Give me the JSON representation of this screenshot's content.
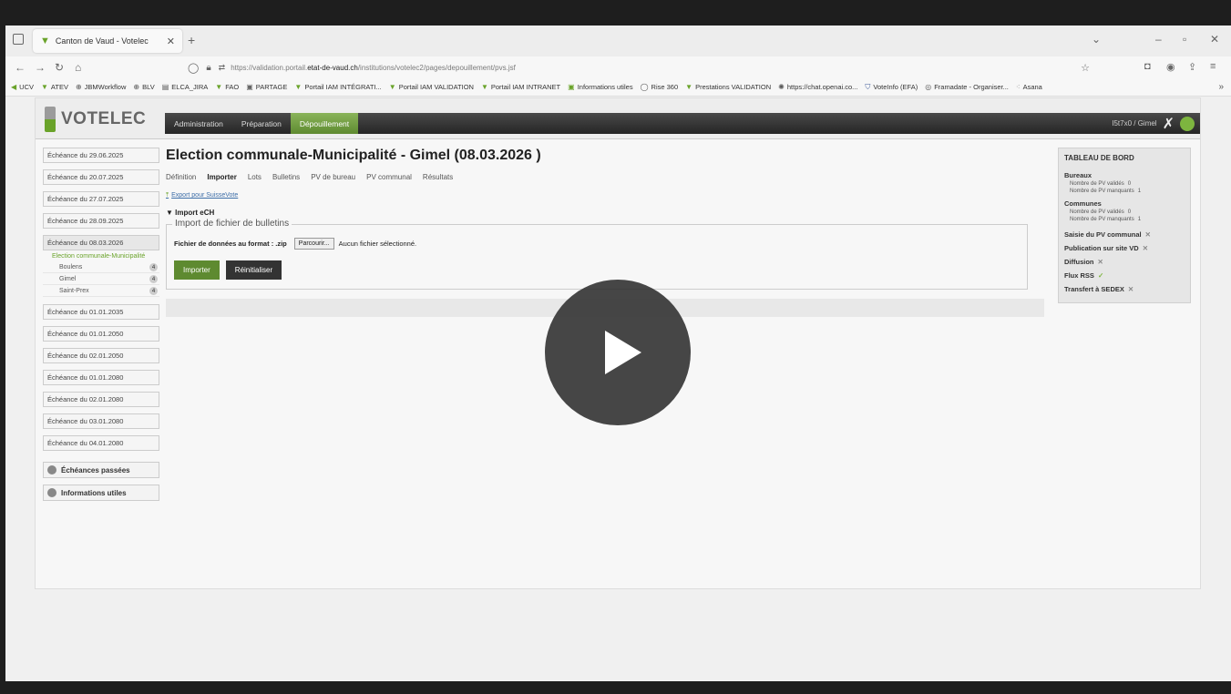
{
  "browser": {
    "tab_title": "Canton de Vaud - Votelec",
    "url_prefix": "https://validation.portail.",
    "url_domain": "etat-de-vaud.ch",
    "url_path": "/institutions/votelec2/pages/depouillement/pvs.jsf",
    "bookmarks": [
      "UCV",
      "ATEV",
      "JBMWorkflow",
      "BLV",
      "ELCA_JIRA",
      "FAO",
      "PARTAGE",
      "Portail IAM INTÉGRATI...",
      "Portail IAM VALIDATION",
      "Portail IAM INTRANET",
      "Informations utiles",
      "Rise 360",
      "Prestations VALIDATION",
      "https://chat.openai.co...",
      "VoteInfo (EFA)",
      "Framadate - Organiser...",
      "Asana"
    ]
  },
  "app": {
    "brand": "VOTELEC",
    "menu": [
      "Administration",
      "Préparation",
      "Dépouillement"
    ],
    "active_menu": "Dépouillement",
    "user": "I5t7x0 / Gimel"
  },
  "left": {
    "items_before": [
      "Échéance du 29.06.2025",
      "Échéance du 20.07.2025",
      "Échéance du 27.07.2025",
      "Échéance du 28.09.2025"
    ],
    "open_item": "Échéance du 08.03.2026",
    "open_sub": "Election communale-Municipalité",
    "children": [
      {
        "name": "Boulens",
        "count": "4"
      },
      {
        "name": "Gimel",
        "count": "4"
      },
      {
        "name": "Saint-Prex",
        "count": "4"
      }
    ],
    "items_after": [
      "Échéance du 01.01.2035",
      "Échéance du 01.01.2050",
      "Échéance du 02.01.2050",
      "Échéance du 01.01.2080",
      "Échéance du 02.01.2080",
      "Échéance du 03.01.2080",
      "Échéance du 04.01.2080"
    ],
    "groups": [
      "Échéances passées",
      "Informations utiles"
    ]
  },
  "main": {
    "title": "Election communale-Municipalité - Gimel (08.03.2026 )",
    "tabs": [
      "Définition",
      "Importer",
      "Lots",
      "Bulletins",
      "PV de bureau",
      "PV communal",
      "Résultats"
    ],
    "active_tab": "Importer",
    "export_link": "Export pour SuisseVote",
    "import_section": "Import eCH",
    "fieldset_legend": "Import de fichier de bulletins",
    "file_label": "Fichier de données au format : .zip",
    "browse_label": "Parcourir...",
    "no_file": "Aucun fichier sélectionné.",
    "btn_import": "Importer",
    "btn_reset": "Réinitialiser"
  },
  "dashboard": {
    "title": "TABLEAU DE BORD",
    "bureaux_label": "Bureaux",
    "communes_label": "Communes",
    "pv_valides": "Nombre de PV validés",
    "pv_manquants": "Nombre de PV manquants",
    "bureaux_valides": "0",
    "bureaux_manquants": "1",
    "communes_valides": "0",
    "communes_manquants": "1",
    "actions": [
      {
        "label": "Saisie du PV communal",
        "status": "x"
      },
      {
        "label": "Publication sur site VD",
        "status": "x"
      },
      {
        "label": "Diffusion",
        "status": "x"
      },
      {
        "label": "Flux RSS",
        "status": "ok"
      },
      {
        "label": "Transfert à SEDEX",
        "status": "x"
      }
    ]
  },
  "colors": {
    "accent_green": "#5e8a30",
    "menu_dark": "#2c2c2c"
  }
}
